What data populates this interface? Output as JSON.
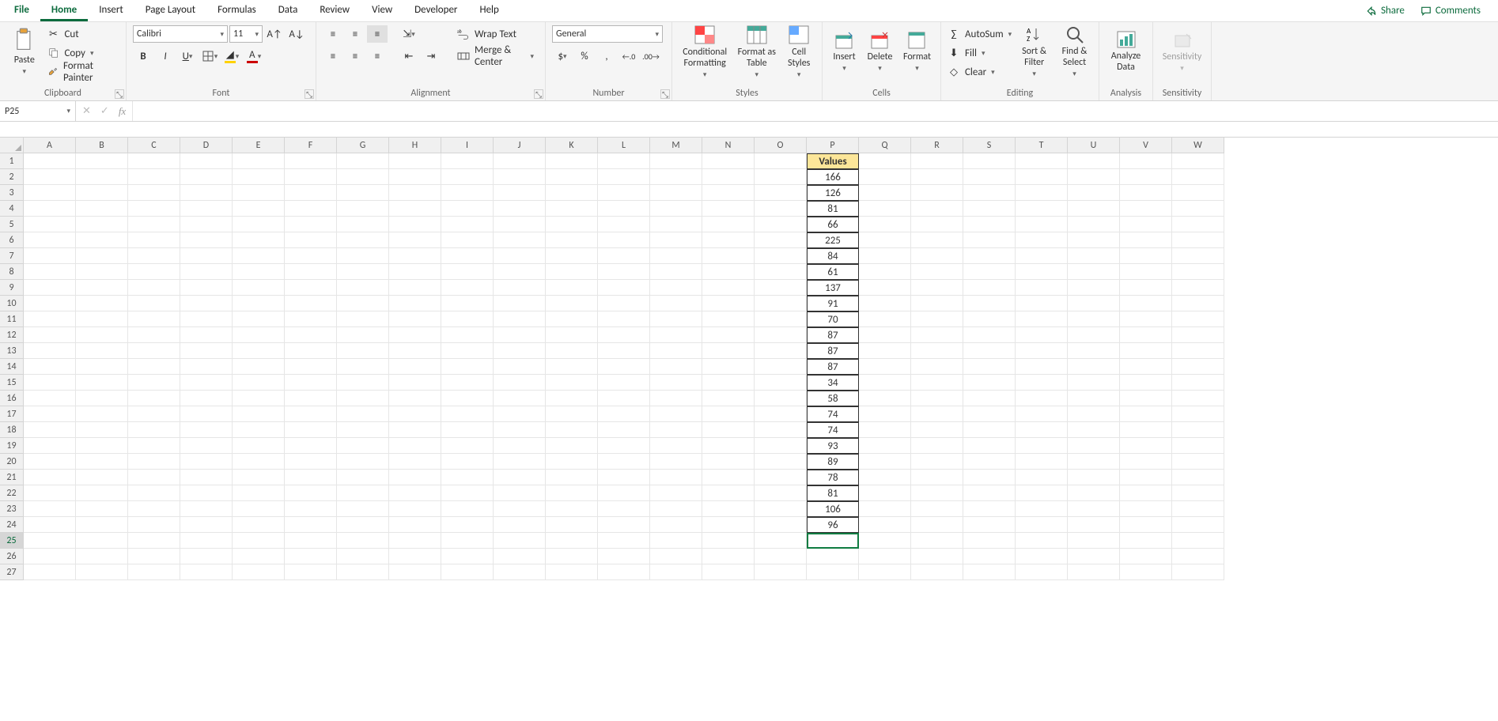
{
  "tabs": {
    "file": "File",
    "home": "Home",
    "insert": "Insert",
    "page_layout": "Page Layout",
    "formulas": "Formulas",
    "data": "Data",
    "review": "Review",
    "view": "View",
    "developer": "Developer",
    "help": "Help"
  },
  "top_right": {
    "share": "Share",
    "comments": "Comments"
  },
  "ribbon": {
    "clipboard": {
      "paste": "Paste",
      "cut": "Cut",
      "copy": "Copy",
      "format_painter": "Format Painter",
      "group_label": "Clipboard"
    },
    "font": {
      "name": "Calibri",
      "size": "11",
      "group_label": "Font"
    },
    "alignment": {
      "wrap_text": "Wrap Text",
      "merge_center": "Merge & Center",
      "group_label": "Alignment"
    },
    "number": {
      "format": "General",
      "group_label": "Number"
    },
    "styles": {
      "conditional_formatting": "Conditional Formatting",
      "format_as_table": "Format as Table",
      "cell_styles": "Cell Styles",
      "group_label": "Styles"
    },
    "cells": {
      "insert": "Insert",
      "delete": "Delete",
      "format": "Format",
      "group_label": "Cells"
    },
    "editing": {
      "autosum": "AutoSum",
      "fill": "Fill",
      "clear": "Clear",
      "sort_filter": "Sort & Filter",
      "find_select": "Find & Select",
      "group_label": "Editing"
    },
    "analysis": {
      "analyze_data": "Analyze Data",
      "group_label": "Analysis"
    },
    "sensitivity": {
      "sensitivity": "Sensitivity",
      "group_label": "Sensitivity"
    }
  },
  "name_box": "P25",
  "formula_bar": "",
  "columns": [
    "A",
    "B",
    "C",
    "D",
    "E",
    "F",
    "G",
    "H",
    "I",
    "J",
    "K",
    "L",
    "M",
    "N",
    "O",
    "P",
    "Q",
    "R",
    "S",
    "T",
    "U",
    "V",
    "W"
  ],
  "row_count": 27,
  "data_header_label": "Values",
  "data_values": [
    166,
    126,
    81,
    66,
    225,
    84,
    61,
    137,
    91,
    70,
    87,
    87,
    87,
    34,
    58,
    74,
    74,
    93,
    89,
    78,
    81,
    106,
    96
  ],
  "selected_cell": "P25",
  "active_row": 25,
  "data_col_index": 15
}
